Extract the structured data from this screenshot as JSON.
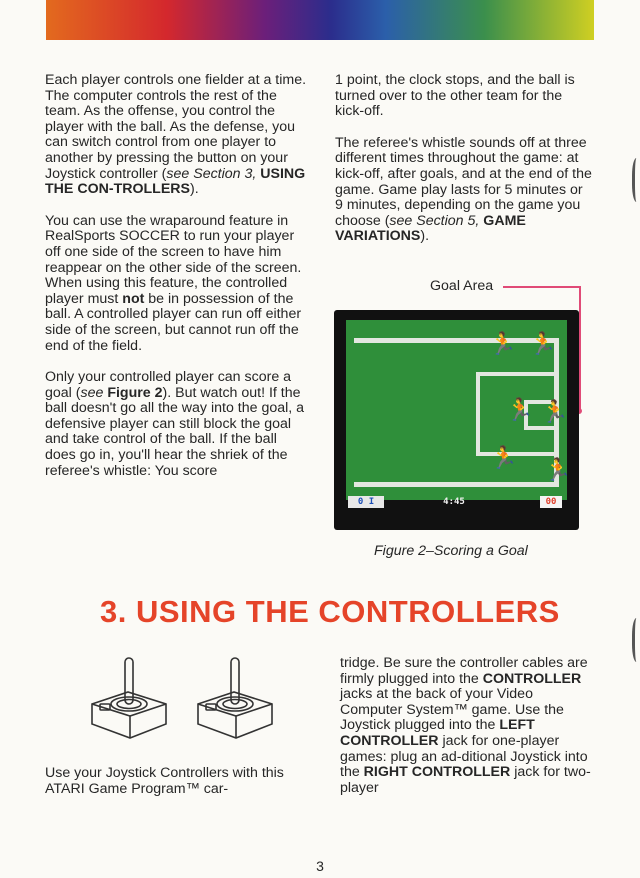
{
  "left_col": {
    "p1": [
      "Each player controls one fielder at a time. The computer controls the rest of the team. As the offense, you control the player with the ball. As the defense, you can switch control from one player to another by pressing the button on your Joystick controller (",
      "see Section 3, ",
      "USING THE CON-TROLLERS",
      ")."
    ],
    "p2": [
      "You can use the wraparound feature in RealSports SOCCER to run your player off one side of the screen to have him reappear on the other side of the screen. When using this feature, the controlled player must ",
      "not",
      " be in possession of the ball. A controlled player can run off either side of the screen, but cannot run off the end of the field."
    ],
    "p3": [
      "Only your controlled player can score a goal (",
      "see ",
      "Figure 2",
      "). But watch out! If the ball doesn't go all the way into the goal, a defensive player can still block the goal and take control of the ball. If the ball does go in, you'll hear the shriek of the referee's whistle: You score"
    ]
  },
  "right_col": {
    "p1": "1 point, the clock stops, and the ball is turned over to the other team for the kick-off.",
    "p2": [
      "The referee's whistle sounds off at three different times throughout the game: at kick-off, after goals, and at the end of the game. Game play lasts for 5 minutes or 9 minutes, depending on the game you choose (",
      "see Section 5, ",
      "GAME VARIATIONS",
      ")."
    ]
  },
  "figure": {
    "goal_area_label": "Goal Area",
    "score_left": "0 I",
    "clock": "4:45",
    "score_right": "00",
    "caption": "Figure 2–Scoring a Goal",
    "colors": {
      "field": "#2f8f3a",
      "team_blue": "#3a6fd8",
      "team_orange": "#e0662a",
      "pointer": "#e04a77"
    }
  },
  "section": {
    "title": "3. USING THE CONTROLLERS",
    "left_text": "Use your Joystick Controllers with this ATARI Game Program™ car-",
    "right_text": [
      "tridge. Be sure the controller cables are firmly plugged into the ",
      "CONTROLLER",
      " jacks at the back of your Video Computer System™ game. Use the Joystick plugged into the ",
      "LEFT CONTROLLER",
      " jack for one-player games: plug an ad-ditional Joystick into the ",
      "RIGHT CONTROLLER",
      " jack for two-player"
    ]
  },
  "page_number": "3"
}
